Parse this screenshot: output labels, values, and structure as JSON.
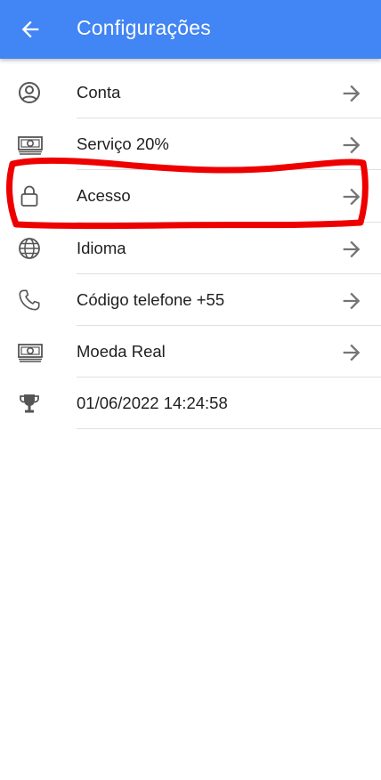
{
  "header": {
    "title": "Configurações",
    "back_icon": "arrow-left-icon",
    "color": "#4285f4"
  },
  "settings": {
    "items": [
      {
        "label": "Conta",
        "icon": "account-circle-icon"
      },
      {
        "label": "Serviço 20%",
        "icon": "money-icon"
      },
      {
        "label": "Acesso",
        "icon": "lock-icon"
      },
      {
        "label": "Idioma",
        "icon": "globe-icon"
      },
      {
        "label": "Código telefone +55",
        "icon": "phone-icon"
      },
      {
        "label": "Moeda Real",
        "icon": "money-icon"
      },
      {
        "label": "01/06/2022 14:24:58",
        "icon": "trophy-icon"
      }
    ]
  },
  "annotation": {
    "color": "#ee0000",
    "target": "Acesso"
  }
}
